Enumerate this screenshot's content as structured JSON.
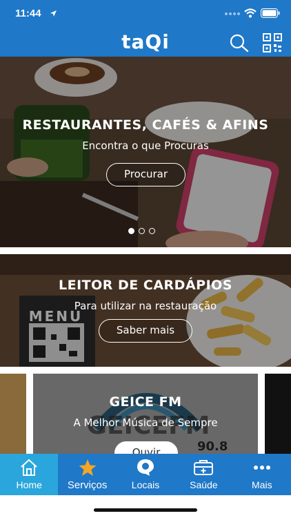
{
  "status": {
    "time": "11:44"
  },
  "header": {
    "logo": "taQi"
  },
  "carousel": {
    "title": "RESTAURANTES, CAFÉS & AFINS",
    "subtitle": "Encontra o que Procuras",
    "button": "Procurar",
    "pages": 3,
    "active_page": 1
  },
  "menu_card": {
    "title": "LEITOR DE CARDÁPIOS",
    "subtitle": "Para utilizar na restauração",
    "button": "Saber mais",
    "menu_sign": "MENU"
  },
  "radio_card": {
    "title": "GEICE FM",
    "subtitle": "A Melhor Música de Sempre",
    "button": "Ouvir",
    "logo_text": "GEICEFM",
    "frequency": "90.8"
  },
  "tabs": [
    {
      "label": "Home",
      "icon": "home-icon",
      "active": true
    },
    {
      "label": "Serviços",
      "icon": "star-icon",
      "active": false
    },
    {
      "label": "Locais",
      "icon": "location-icon",
      "active": false
    },
    {
      "label": "Saúde",
      "icon": "medical-kit-icon",
      "active": false
    },
    {
      "label": "Mais",
      "icon": "more-icon",
      "active": false
    }
  ],
  "colors": {
    "primary": "#1f78c8",
    "active_tab": "#2aa6dc",
    "star": "#f5a623"
  }
}
